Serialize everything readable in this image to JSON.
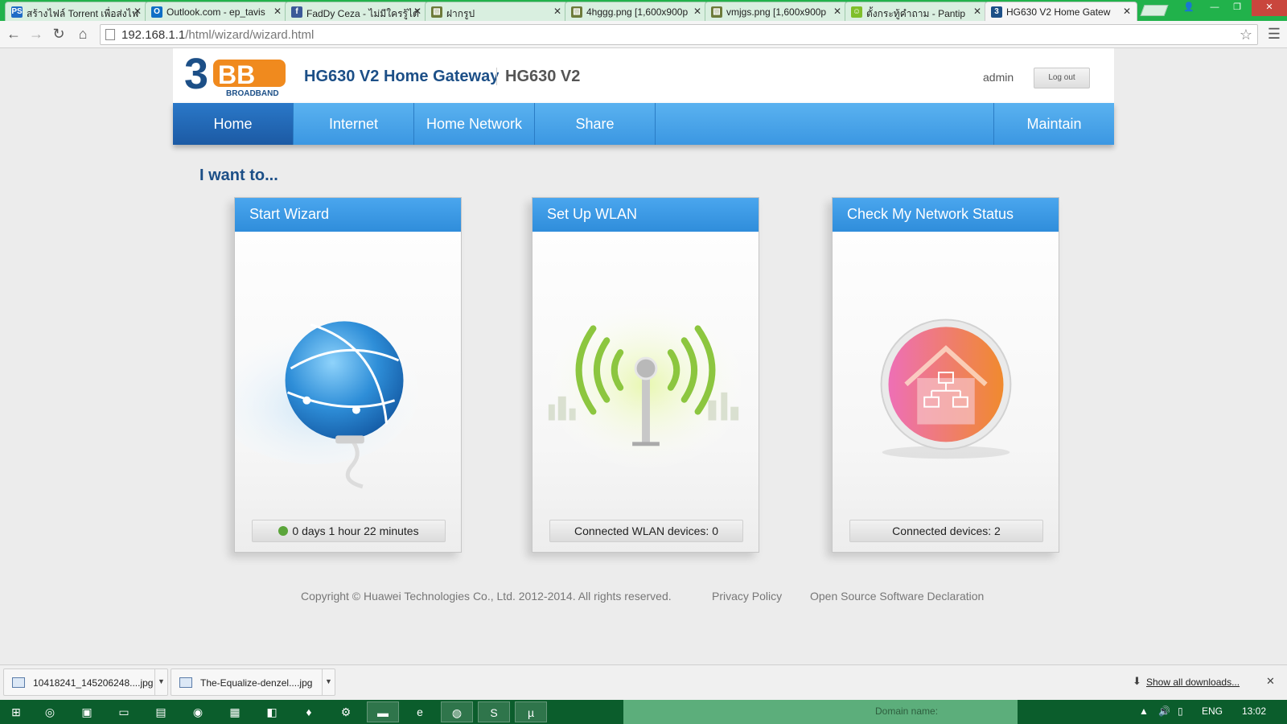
{
  "browser": {
    "tabs": [
      {
        "label": "สร้างไฟล์ Torrent เพื่อส่งไฟ",
        "favicon": "PS",
        "favicon_color": "#1f6cc6"
      },
      {
        "label": "Outlook.com - ep_tavis",
        "favicon": "O",
        "favicon_color": "#0f6fc6"
      },
      {
        "label": "FadDy Ceza - ไม่มีใครรู้ได้",
        "favicon": "f",
        "favicon_color": "#3b5998"
      },
      {
        "label": "ฝากรูป",
        "favicon": "▧",
        "favicon_color": "#6d7b3a"
      },
      {
        "label": "4hggg.png [1,600x900p",
        "favicon": "▧",
        "favicon_color": "#6d7b3a"
      },
      {
        "label": "vmjgs.png [1,600x900p",
        "favicon": "▧",
        "favicon_color": "#6d7b3a"
      },
      {
        "label": "ตั้งกระทู้คำถาม - Pantip",
        "favicon": "☺",
        "favicon_color": "#7fbf2a"
      },
      {
        "label": "HG630 V2 Home Gatew",
        "favicon": "3",
        "favicon_color": "#1c4f87",
        "active": true
      }
    ],
    "url_host": "192.168.1.1",
    "url_path": "/html/wizard/wizard.html"
  },
  "router": {
    "brand_main": "3BB",
    "brand_sub": "BROADBAND",
    "product_title": "HG630 V2 Home Gateway",
    "model": "HG630 V2",
    "username": "admin",
    "logout_label": "Log out",
    "nav": [
      {
        "label": "Home",
        "active": true
      },
      {
        "label": "Internet"
      },
      {
        "label": "Home Network"
      },
      {
        "label": "Share"
      },
      {
        "label": "Maintain"
      }
    ],
    "section_title": "I want to...",
    "cards": [
      {
        "title": "Start Wizard",
        "footer": "0 days 1 hour 22 minutes",
        "icon": "globe-icon"
      },
      {
        "title": "Set Up WLAN",
        "footer": "Connected WLAN devices: 0",
        "icon": "wifi-antenna-icon"
      },
      {
        "title": "Check My Network Status",
        "footer": "Connected devices: 2",
        "icon": "home-network-icon"
      }
    ],
    "footer": {
      "copyright": "Copyright © Huawei Technologies Co., Ltd. 2012-2014. All rights reserved.",
      "privacy": "Privacy Policy",
      "opensource": "Open Source Software Declaration"
    }
  },
  "downloads": {
    "items": [
      "10418241_145206248....jpg",
      "The-Equalize-denzel....jpg"
    ],
    "show_all": "Show all downloads..."
  },
  "taskbar": {
    "preview_text": "Domain name:",
    "language": "ENG",
    "time": "13:02"
  },
  "colors": {
    "nav_blue": "#3b97e2",
    "brand_blue": "#1c4f87",
    "brand_orange": "#f08a1e",
    "tabstrip_green": "#21b24b"
  }
}
